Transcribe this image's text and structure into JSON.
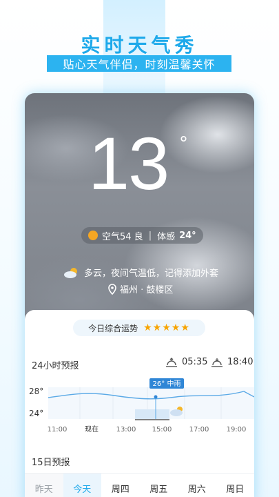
{
  "headline": "实时天气秀",
  "subline": "贴心天气伴侣，时刻温馨关怀",
  "weather": {
    "temperature": "13",
    "degree": "°",
    "air_label": "空气54 良",
    "feels_label": "体感",
    "feels_value": "24°",
    "tip": "多云，夜间气温低，记得添加外套",
    "location": "福州 · 鼓楼区"
  },
  "fortune": {
    "label": "今日综合运势",
    "stars": "★★★★★"
  },
  "hourly": {
    "title": "24小时预报",
    "sunrise": "05:35",
    "sunset": "18:40",
    "y_high": "28°",
    "y_low": "24°",
    "badge": "26° 中雨",
    "times": [
      "11:00",
      "现在",
      "13:00",
      "15:00",
      "17:00",
      "19:00"
    ]
  },
  "daily": {
    "title": "15日预报",
    "days": [
      "昨天",
      "今天",
      "周四",
      "周五",
      "周六",
      "周日"
    ]
  },
  "colors": {
    "accent": "#1ea9ea",
    "star": "#f7a400",
    "sun_dot": "#f5a623"
  }
}
